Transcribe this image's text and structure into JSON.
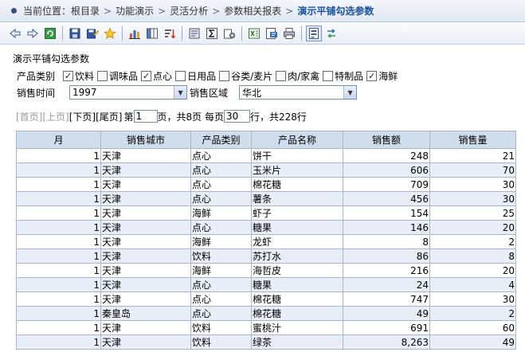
{
  "breadcrumb": {
    "label": "当前位置：",
    "items": [
      "根目录",
      "功能演示",
      "灵活分析",
      "参数相关报表"
    ],
    "current": "演示平铺勾选参数"
  },
  "toolbar": {
    "buttons": [
      "back-icon",
      "forward-icon",
      "refresh-icon",
      "save-icon",
      "save-as-icon",
      "favorite-icon",
      "chart-icon",
      "column-icon",
      "sort-icon",
      "print-setup-icon",
      "sum-icon",
      "settings-icon",
      "export-excel-icon",
      "export-pdf-icon",
      "print-icon",
      "params-icon",
      "switch-icon"
    ]
  },
  "report": {
    "title": "演示平铺勾选参数",
    "category_label": "产品类别",
    "categories": [
      {
        "label": "饮料",
        "checked": true
      },
      {
        "label": "调味品",
        "checked": false
      },
      {
        "label": "点心",
        "checked": true
      },
      {
        "label": "日用品",
        "checked": false
      },
      {
        "label": "谷类/麦片",
        "checked": false
      },
      {
        "label": "肉/家禽",
        "checked": false
      },
      {
        "label": "特制品",
        "checked": false
      },
      {
        "label": "海鲜",
        "checked": true
      }
    ],
    "time_label": "销售时间",
    "time_value": "1997",
    "region_label": "销售区域",
    "region_value": "华北"
  },
  "pager": {
    "first": "[首页]",
    "prev": "[上页]",
    "next": "[下页]",
    "last": "[尾页]",
    "page_prefix": "第",
    "page_value": "1",
    "page_suffix": "页，共8页 每页",
    "rows_value": "30",
    "rows_suffix": "行，共228行"
  },
  "table": {
    "headers": [
      "月",
      "销售城市",
      "产品类别",
      "产品名称",
      "销售额",
      "销售量"
    ],
    "rows": [
      [
        "1",
        "天津",
        "点心",
        "饼干",
        "248",
        "21"
      ],
      [
        "1",
        "天津",
        "点心",
        "玉米片",
        "606",
        "70"
      ],
      [
        "1",
        "天津",
        "点心",
        "棉花糖",
        "709",
        "30"
      ],
      [
        "1",
        "天津",
        "点心",
        "薯条",
        "456",
        "30"
      ],
      [
        "1",
        "天津",
        "海鲜",
        "虾子",
        "154",
        "25"
      ],
      [
        "1",
        "天津",
        "点心",
        "糖果",
        "146",
        "20"
      ],
      [
        "1",
        "天津",
        "海鲜",
        "龙虾",
        "8",
        "2"
      ],
      [
        "1",
        "天津",
        "饮料",
        "苏打水",
        "86",
        "8"
      ],
      [
        "1",
        "天津",
        "海鲜",
        "海哲皮",
        "216",
        "20"
      ],
      [
        "1",
        "天津",
        "点心",
        "糖果",
        "24",
        "4"
      ],
      [
        "1",
        "天津",
        "点心",
        "棉花糖",
        "747",
        "30"
      ],
      [
        "1",
        "秦皇岛",
        "点心",
        "棉花糖",
        "49",
        "2"
      ],
      [
        "1",
        "天津",
        "饮料",
        "蜜桃汁",
        "691",
        "60"
      ],
      [
        "1",
        "天津",
        "饮料",
        "绿茶",
        "8,263",
        "49"
      ]
    ]
  }
}
